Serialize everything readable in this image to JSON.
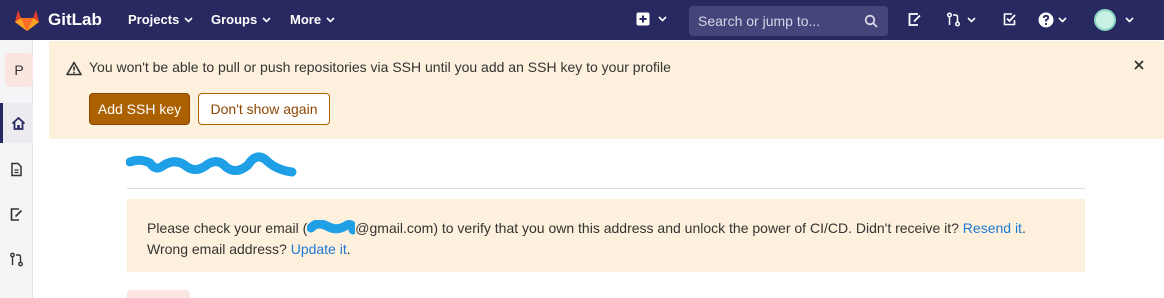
{
  "navbar": {
    "brand": "GitLab",
    "links": {
      "projects": "Projects",
      "groups": "Groups",
      "more": "More"
    },
    "search_placeholder": "Search or jump to...",
    "icons": [
      "plus-square-icon",
      "chevron-down-icon",
      "search-icon",
      "issues-icon",
      "merge-request-icon",
      "todo-check-icon",
      "help-icon",
      "avatar"
    ]
  },
  "sidebar": {
    "project_initial": "P",
    "items": [
      "home-icon",
      "document-icon",
      "issues-icon",
      "merge-request-icon"
    ]
  },
  "ssh_banner": {
    "message": "You won't be able to pull or push repositories via SSH until you add an SSH key to your profile",
    "add_button": "Add SSH key",
    "dismiss_button": "Don't show again"
  },
  "email_alert": {
    "prefix": "Please check your email (",
    "email_suffix": "@gmail.com",
    "middle": ") to verify that you own this address and unlock the power of CI/CD. Didn't receive it?",
    "resend_link": "Resend it",
    "after_resend": ".",
    "wrong_email": "Wrong email address?",
    "update_link": "Update it",
    "after_update": "."
  },
  "colors": {
    "navbar_bg": "#292961",
    "banner_bg": "#fdf1dd",
    "primary_button": "#ab6100",
    "link": "#1f78d1",
    "redaction": "#1fa0e6"
  }
}
